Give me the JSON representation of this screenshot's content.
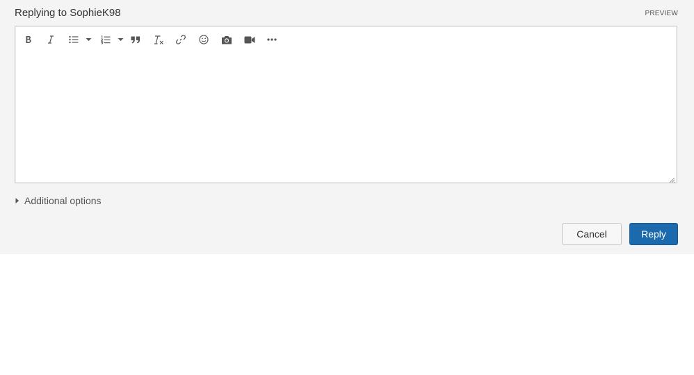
{
  "reply": {
    "heading": "Replying to SophieK98",
    "preview_label": "PREVIEW"
  },
  "toolbar": {
    "icons": [
      "bold-icon",
      "italic-icon",
      "bullet-list-icon",
      "chevron-down-icon",
      "numbered-list-icon",
      "chevron-down-icon",
      "quote-icon",
      "clear-formatting-icon",
      "link-icon",
      "emoji-icon",
      "camera-icon",
      "video-icon",
      "more-icon"
    ]
  },
  "editor": {
    "content": ""
  },
  "options": {
    "additional_label": "Additional options"
  },
  "actions": {
    "cancel_label": "Cancel",
    "reply_label": "Reply"
  },
  "colors": {
    "panel_bg": "#f4f4f4",
    "accent": "#1b6aae",
    "icon": "#555555"
  }
}
